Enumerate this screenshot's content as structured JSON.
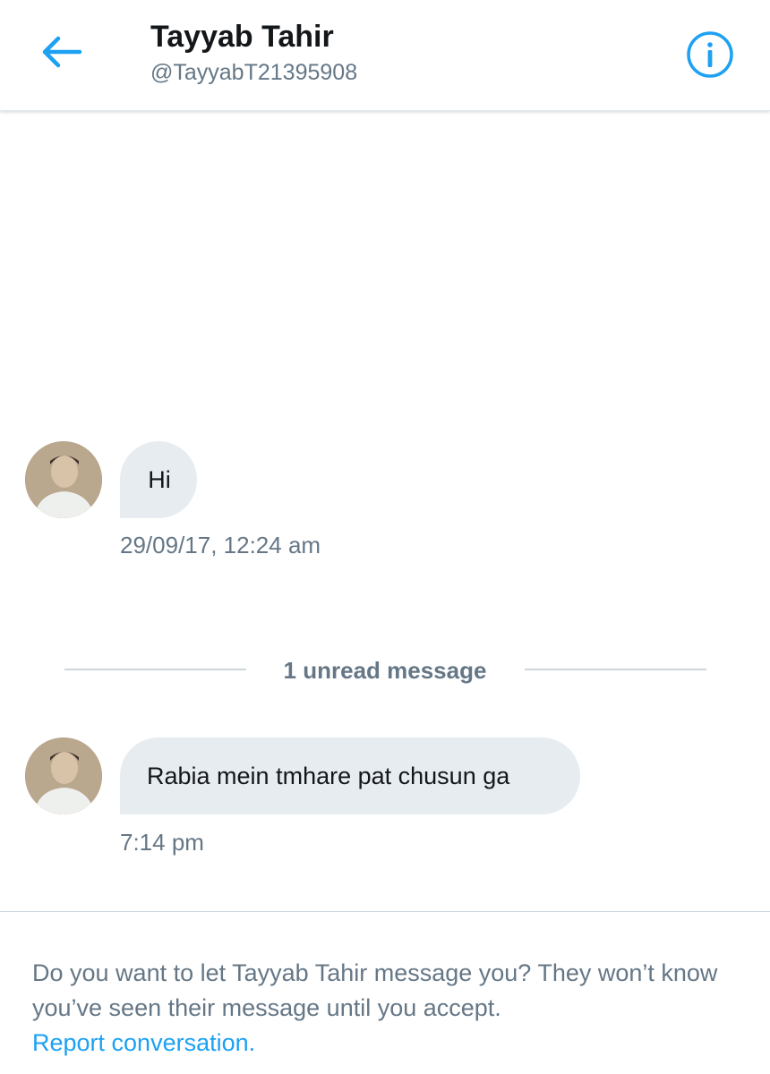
{
  "header": {
    "title": "Tayyab Tahir",
    "handle": "@TayyabT21395908",
    "back_icon": "arrow-left-icon",
    "info_icon": "info-circle-icon"
  },
  "messages": [
    {
      "text": "Hi",
      "timestamp": "29/09/17, 12:24 am"
    },
    {
      "text": "Rabia mein tmhare pat chusun ga",
      "timestamp": "7:14 pm"
    }
  ],
  "unread_divider": {
    "label": "1 unread message"
  },
  "message_request": {
    "prompt": "Do you want to let Tayyab Tahir message you? They won’t know you’ve seen their message until you accept.",
    "report_link": "Report conversation."
  },
  "colors": {
    "accent": "#1da1f2",
    "bubble": "#e6ecf0",
    "secondary_text": "#657786",
    "divider": "#ccd6dd"
  }
}
